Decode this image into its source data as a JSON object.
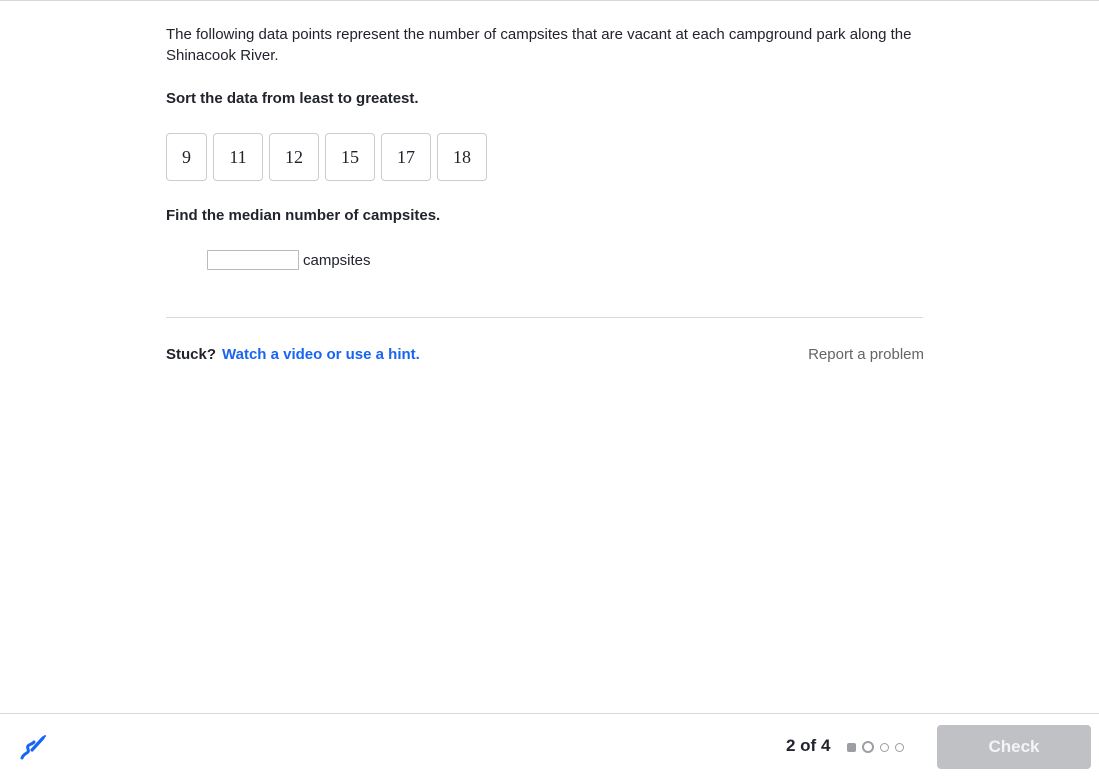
{
  "question": {
    "prompt": "The following data points represent the number of campsites that are vacant at each campground park along the Shinacook River.",
    "instruction": "Sort the data from least to greatest.",
    "tiles": [
      "9",
      "11",
      "12",
      "15",
      "17",
      "18"
    ],
    "median_prompt": "Find the median number of campsites.",
    "answer_value": "",
    "answer_placeholder": "",
    "unit_label": "campsites"
  },
  "help": {
    "stuck_label": "Stuck?",
    "hint_link": "Watch a video or use a hint.",
    "report_link": "Report a problem"
  },
  "footer": {
    "progress_text": "2 of 4",
    "progress_current": 2,
    "progress_total": 4,
    "check_label": "Check",
    "check_enabled": false,
    "scratchpad_icon": "pen-icon"
  },
  "colors": {
    "link": "#1865f2",
    "text": "#21242c",
    "muted": "#626569",
    "button_disabled": "#bfc1c5",
    "divider": "#d6d8da"
  }
}
